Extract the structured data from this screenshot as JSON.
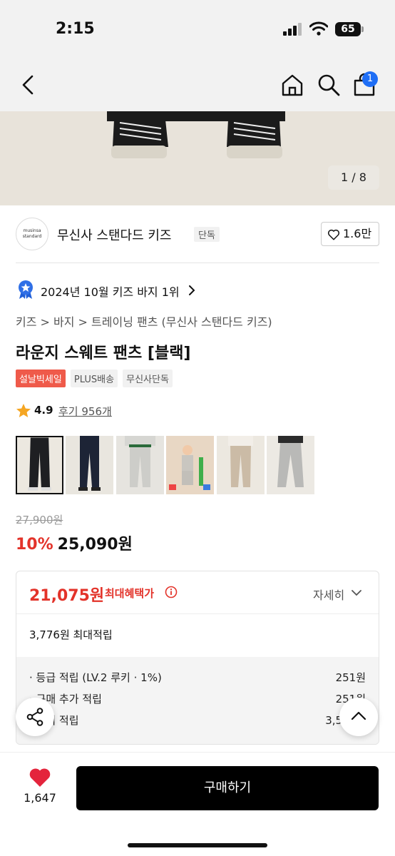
{
  "status_bar": {
    "time": "2:15",
    "battery": "65"
  },
  "nav": {
    "cart_count": "1"
  },
  "hero": {
    "counter": "1 / 8 "
  },
  "brand": {
    "logo_text": "musinsa standard",
    "name": "무신사 스탠다드 키즈",
    "tag": "단독",
    "likes": "1.6만"
  },
  "ranking": {
    "text": "2024년 10월 키즈 바지 1위"
  },
  "breadcrumb": "키즈 > 바지 > 트레이닝 팬츠 (무신사 스탠다드 키즈)",
  "product": {
    "title": "라운지 스웨트 팬츠 [블랙]",
    "tags": [
      "설날빅세일",
      "PLUS배송",
      "무신사단독"
    ],
    "rating": "4.9",
    "review_link": "후기 956개",
    "original_price": "27,900원",
    "discount": "10%",
    "price": "25,090원"
  },
  "thumbnails": [
    {
      "name": "black",
      "color": "#1e1f22"
    },
    {
      "name": "navy",
      "color": "#1d2436"
    },
    {
      "name": "light-gray",
      "color": "#cdcdc9"
    },
    {
      "name": "gray-kid",
      "color": "#c9c6c0"
    },
    {
      "name": "beige",
      "color": "#cbbba6"
    },
    {
      "name": "melange-gray",
      "color": "#b9b9b7"
    }
  ],
  "benefit": {
    "max_price": "21,075원",
    "max_label": "최대혜택가",
    "detail_label": "자세히",
    "points": "3,776원 최대적립",
    "rows": [
      {
        "label": "· 등급 적립 (LV.2 루키 · 1%)",
        "value": "251원"
      },
      {
        "label": "· 구매 추가 적립",
        "value": "251원"
      },
      {
        "label": "· 후기 적립",
        "value": "3,500원"
      }
    ]
  },
  "bottom": {
    "like_count": "1,647",
    "buy_label": "구매하기"
  },
  "colors": {
    "accent_red": "#e3332a",
    "sale_tag": "#ef5a4a",
    "badge_blue": "#1f6ef5",
    "heart": "#e4243c"
  }
}
